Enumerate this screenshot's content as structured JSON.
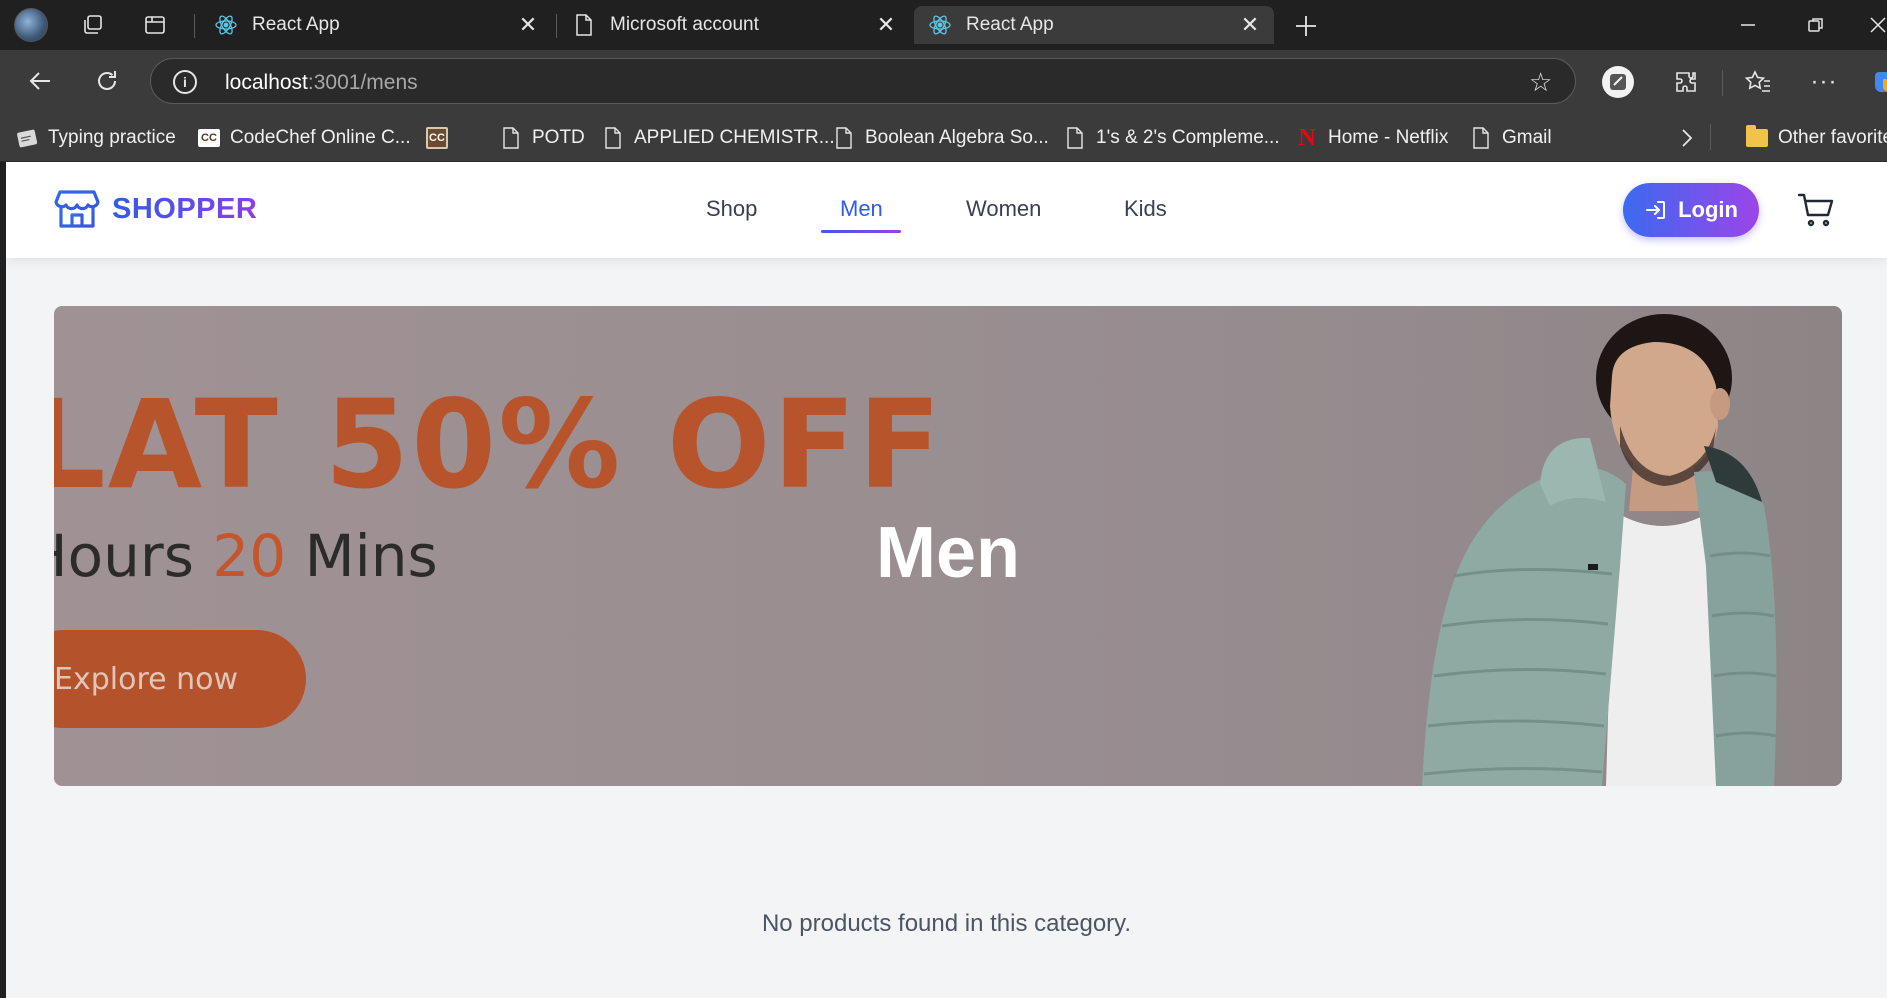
{
  "browser": {
    "tabs": [
      {
        "title": "React App",
        "favicon": "react-icon",
        "active": false
      },
      {
        "title": "Microsoft account",
        "favicon": "page-icon",
        "active": false
      },
      {
        "title": "React App",
        "favicon": "react-icon",
        "active": true
      }
    ],
    "address": {
      "host": "localhost",
      "path": ":3001/mens"
    },
    "bookmarks": [
      {
        "label": "Typing practice",
        "icon": "typing-icon"
      },
      {
        "label": "CodeChef Online C...",
        "icon": "codechef-icon"
      },
      {
        "label": "",
        "icon": "codechef-icon"
      },
      {
        "label": "POTD",
        "icon": "page-icon"
      },
      {
        "label": "APPLIED CHEMISTR...",
        "icon": "page-icon"
      },
      {
        "label": "Boolean Algebra So...",
        "icon": "page-icon"
      },
      {
        "label": "1's & 2's Compleme...",
        "icon": "page-icon"
      },
      {
        "label": "Home - Netflix",
        "icon": "netflix-icon"
      },
      {
        "label": "Gmail",
        "icon": "page-icon"
      },
      {
        "label": "Other favorite",
        "icon": "folder-icon"
      }
    ]
  },
  "site": {
    "brand": "SHOPPER",
    "nav": [
      {
        "label": "Shop",
        "active": false
      },
      {
        "label": "Men",
        "active": true
      },
      {
        "label": "Women",
        "active": false
      },
      {
        "label": "Kids",
        "active": false
      }
    ],
    "login_label": "Login",
    "colors": {
      "brand_start": "#2f5ce8",
      "brand_end": "#8b3ee8",
      "page_bg": "#f3f4f6",
      "offer_orange": "#b8542c"
    }
  },
  "hero": {
    "offer_text": "LAT 50% OFF",
    "timer_before": "Hours ",
    "timer_highlight": "20",
    "timer_after": " Mins",
    "cta_label": "Explore now",
    "title": "Men"
  },
  "content": {
    "empty_message": "No products found in this category."
  }
}
